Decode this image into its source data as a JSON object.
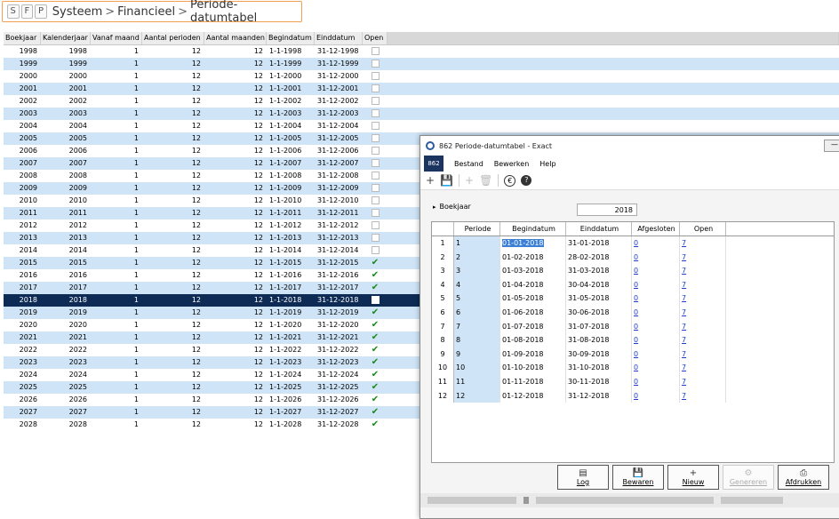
{
  "breadcrumb": {
    "buttons": [
      "S",
      "F",
      "P"
    ],
    "items": [
      "Systeem",
      "Financieel",
      "Periode-datumtabel"
    ],
    "separator": ">"
  },
  "table": {
    "columns": [
      "Boekjaar",
      "Kalenderjaar",
      "Vanaf maand",
      "Aantal perioden",
      "Aantal maanden",
      "Begindatum",
      "Einddatum",
      "Open"
    ],
    "rows": [
      {
        "boekjaar": "1998",
        "kalenderjaar": "1998",
        "vanaf": "1",
        "perioden": "12",
        "maanden": "12",
        "begin": "1-1-1998",
        "eind": "31-12-1998",
        "open": "box"
      },
      {
        "boekjaar": "1999",
        "kalenderjaar": "1999",
        "vanaf": "1",
        "perioden": "12",
        "maanden": "12",
        "begin": "1-1-1999",
        "eind": "31-12-1999",
        "open": "box"
      },
      {
        "boekjaar": "2000",
        "kalenderjaar": "2000",
        "vanaf": "1",
        "perioden": "12",
        "maanden": "12",
        "begin": "1-1-2000",
        "eind": "31-12-2000",
        "open": "box"
      },
      {
        "boekjaar": "2001",
        "kalenderjaar": "2001",
        "vanaf": "1",
        "perioden": "12",
        "maanden": "12",
        "begin": "1-1-2001",
        "eind": "31-12-2001",
        "open": "box"
      },
      {
        "boekjaar": "2002",
        "kalenderjaar": "2002",
        "vanaf": "1",
        "perioden": "12",
        "maanden": "12",
        "begin": "1-1-2002",
        "eind": "31-12-2002",
        "open": "box"
      },
      {
        "boekjaar": "2003",
        "kalenderjaar": "2003",
        "vanaf": "1",
        "perioden": "12",
        "maanden": "12",
        "begin": "1-1-2003",
        "eind": "31-12-2003",
        "open": "box"
      },
      {
        "boekjaar": "2004",
        "kalenderjaar": "2004",
        "vanaf": "1",
        "perioden": "12",
        "maanden": "12",
        "begin": "1-1-2004",
        "eind": "31-12-2004",
        "open": "box"
      },
      {
        "boekjaar": "2005",
        "kalenderjaar": "2005",
        "vanaf": "1",
        "perioden": "12",
        "maanden": "12",
        "begin": "1-1-2005",
        "eind": "31-12-2005",
        "open": "box"
      },
      {
        "boekjaar": "2006",
        "kalenderjaar": "2006",
        "vanaf": "1",
        "perioden": "12",
        "maanden": "12",
        "begin": "1-1-2006",
        "eind": "31-12-2006",
        "open": "box"
      },
      {
        "boekjaar": "2007",
        "kalenderjaar": "2007",
        "vanaf": "1",
        "perioden": "12",
        "maanden": "12",
        "begin": "1-1-2007",
        "eind": "31-12-2007",
        "open": "box"
      },
      {
        "boekjaar": "2008",
        "kalenderjaar": "2008",
        "vanaf": "1",
        "perioden": "12",
        "maanden": "12",
        "begin": "1-1-2008",
        "eind": "31-12-2008",
        "open": "box"
      },
      {
        "boekjaar": "2009",
        "kalenderjaar": "2009",
        "vanaf": "1",
        "perioden": "12",
        "maanden": "12",
        "begin": "1-1-2009",
        "eind": "31-12-2009",
        "open": "box"
      },
      {
        "boekjaar": "2010",
        "kalenderjaar": "2010",
        "vanaf": "1",
        "perioden": "12",
        "maanden": "12",
        "begin": "1-1-2010",
        "eind": "31-12-2010",
        "open": "box"
      },
      {
        "boekjaar": "2011",
        "kalenderjaar": "2011",
        "vanaf": "1",
        "perioden": "12",
        "maanden": "12",
        "begin": "1-1-2011",
        "eind": "31-12-2011",
        "open": "box"
      },
      {
        "boekjaar": "2012",
        "kalenderjaar": "2012",
        "vanaf": "1",
        "perioden": "12",
        "maanden": "12",
        "begin": "1-1-2012",
        "eind": "31-12-2012",
        "open": "box"
      },
      {
        "boekjaar": "2013",
        "kalenderjaar": "2013",
        "vanaf": "1",
        "perioden": "12",
        "maanden": "12",
        "begin": "1-1-2013",
        "eind": "31-12-2013",
        "open": "box"
      },
      {
        "boekjaar": "2014",
        "kalenderjaar": "2014",
        "vanaf": "1",
        "perioden": "12",
        "maanden": "12",
        "begin": "1-1-2014",
        "eind": "31-12-2014",
        "open": "box"
      },
      {
        "boekjaar": "2015",
        "kalenderjaar": "2015",
        "vanaf": "1",
        "perioden": "12",
        "maanden": "12",
        "begin": "1-1-2015",
        "eind": "31-12-2015",
        "open": "check"
      },
      {
        "boekjaar": "2016",
        "kalenderjaar": "2016",
        "vanaf": "1",
        "perioden": "12",
        "maanden": "12",
        "begin": "1-1-2016",
        "eind": "31-12-2016",
        "open": "check"
      },
      {
        "boekjaar": "2017",
        "kalenderjaar": "2017",
        "vanaf": "1",
        "perioden": "12",
        "maanden": "12",
        "begin": "1-1-2017",
        "eind": "31-12-2017",
        "open": "check"
      },
      {
        "boekjaar": "2018",
        "kalenderjaar": "2018",
        "vanaf": "1",
        "perioden": "12",
        "maanden": "12",
        "begin": "1-1-2018",
        "eind": "31-12-2018",
        "open": "box"
      },
      {
        "boekjaar": "2019",
        "kalenderjaar": "2019",
        "vanaf": "1",
        "perioden": "12",
        "maanden": "12",
        "begin": "1-1-2019",
        "eind": "31-12-2019",
        "open": "check"
      },
      {
        "boekjaar": "2020",
        "kalenderjaar": "2020",
        "vanaf": "1",
        "perioden": "12",
        "maanden": "12",
        "begin": "1-1-2020",
        "eind": "31-12-2020",
        "open": "check"
      },
      {
        "boekjaar": "2021",
        "kalenderjaar": "2021",
        "vanaf": "1",
        "perioden": "12",
        "maanden": "12",
        "begin": "1-1-2021",
        "eind": "31-12-2021",
        "open": "check"
      },
      {
        "boekjaar": "2022",
        "kalenderjaar": "2022",
        "vanaf": "1",
        "perioden": "12",
        "maanden": "12",
        "begin": "1-1-2022",
        "eind": "31-12-2022",
        "open": "check"
      },
      {
        "boekjaar": "2023",
        "kalenderjaar": "2023",
        "vanaf": "1",
        "perioden": "12",
        "maanden": "12",
        "begin": "1-1-2023",
        "eind": "31-12-2023",
        "open": "check"
      },
      {
        "boekjaar": "2024",
        "kalenderjaar": "2024",
        "vanaf": "1",
        "perioden": "12",
        "maanden": "12",
        "begin": "1-1-2024",
        "eind": "31-12-2024",
        "open": "check"
      },
      {
        "boekjaar": "2025",
        "kalenderjaar": "2025",
        "vanaf": "1",
        "perioden": "12",
        "maanden": "12",
        "begin": "1-1-2025",
        "eind": "31-12-2025",
        "open": "check"
      },
      {
        "boekjaar": "2026",
        "kalenderjaar": "2026",
        "vanaf": "1",
        "perioden": "12",
        "maanden": "12",
        "begin": "1-1-2026",
        "eind": "31-12-2026",
        "open": "check"
      },
      {
        "boekjaar": "2027",
        "kalenderjaar": "2027",
        "vanaf": "1",
        "perioden": "12",
        "maanden": "12",
        "begin": "1-1-2027",
        "eind": "31-12-2027",
        "open": "check"
      },
      {
        "boekjaar": "2028",
        "kalenderjaar": "2028",
        "vanaf": "1",
        "perioden": "12",
        "maanden": "12",
        "begin": "1-1-2028",
        "eind": "31-12-2028",
        "open": "check"
      }
    ],
    "selected_boekjaar": "2018"
  },
  "dialog": {
    "title": "862 Periode-datumtabel - Exact",
    "code": "862",
    "menu": [
      "Bestand",
      "Bewerken",
      "Help"
    ],
    "toolbar_icons": [
      "new-icon",
      "save-icon",
      "add-icon",
      "delete-icon",
      "euro-icon",
      "help-icon"
    ],
    "boekjaar_label": "Boekjaar",
    "boekjaar_value": "2018",
    "columns": [
      "Periode",
      "Begindatum",
      "Einddatum",
      "Afgesloten",
      "Open"
    ],
    "rows": [
      {
        "n": "1",
        "periode": "1",
        "begin": "01-01-2018",
        "eind": "31-01-2018",
        "afgesloten": "0",
        "open": "7"
      },
      {
        "n": "2",
        "periode": "2",
        "begin": "01-02-2018",
        "eind": "28-02-2018",
        "afgesloten": "0",
        "open": "7"
      },
      {
        "n": "3",
        "periode": "3",
        "begin": "01-03-2018",
        "eind": "31-03-2018",
        "afgesloten": "0",
        "open": "7"
      },
      {
        "n": "4",
        "periode": "4",
        "begin": "01-04-2018",
        "eind": "30-04-2018",
        "afgesloten": "0",
        "open": "7"
      },
      {
        "n": "5",
        "periode": "5",
        "begin": "01-05-2018",
        "eind": "31-05-2018",
        "afgesloten": "0",
        "open": "7"
      },
      {
        "n": "6",
        "periode": "6",
        "begin": "01-06-2018",
        "eind": "30-06-2018",
        "afgesloten": "0",
        "open": "7"
      },
      {
        "n": "7",
        "periode": "7",
        "begin": "01-07-2018",
        "eind": "31-07-2018",
        "afgesloten": "0",
        "open": "7"
      },
      {
        "n": "8",
        "periode": "8",
        "begin": "01-08-2018",
        "eind": "31-08-2018",
        "afgesloten": "0",
        "open": "7"
      },
      {
        "n": "9",
        "periode": "9",
        "begin": "01-09-2018",
        "eind": "30-09-2018",
        "afgesloten": "0",
        "open": "7"
      },
      {
        "n": "10",
        "periode": "10",
        "begin": "01-10-2018",
        "eind": "31-10-2018",
        "afgesloten": "0",
        "open": "7"
      },
      {
        "n": "11",
        "periode": "11",
        "begin": "01-11-2018",
        "eind": "30-11-2018",
        "afgesloten": "0",
        "open": "7"
      },
      {
        "n": "12",
        "periode": "12",
        "begin": "01-12-2018",
        "eind": "31-12-2018",
        "afgesloten": "0",
        "open": "7"
      }
    ],
    "buttons": [
      {
        "label": "Log",
        "icon": "log-icon",
        "enabled": true
      },
      {
        "label": "Bewaren",
        "icon": "save-icon",
        "enabled": true
      },
      {
        "label": "Nieuw",
        "icon": "plus-icon",
        "enabled": true
      },
      {
        "label": "Genereren",
        "icon": "gear-icon",
        "enabled": false
      },
      {
        "label": "Afdrukken",
        "icon": "printer-icon",
        "enabled": true
      }
    ]
  },
  "colors": {
    "accent_orange": "#f0a050",
    "alt_row": "#cfe4f7",
    "selected_row": "#0d2b54",
    "check_green": "#1a8a1a",
    "link_blue": "#1a3fd0"
  }
}
